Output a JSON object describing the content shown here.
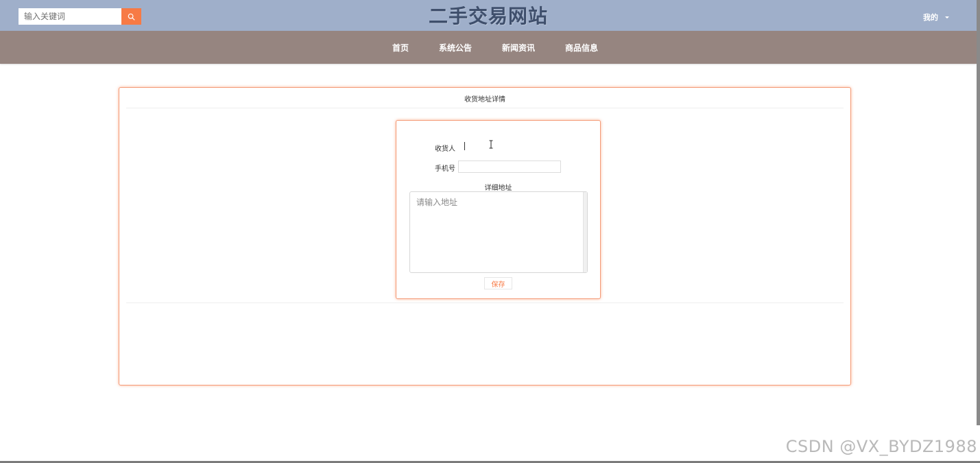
{
  "header": {
    "search": {
      "placeholder": "输入关键词",
      "value": ""
    },
    "site_title": "二手交易网站",
    "user_menu_label": "我的"
  },
  "nav": {
    "items": [
      {
        "label": "首页"
      },
      {
        "label": "系统公告"
      },
      {
        "label": "新闻资讯"
      },
      {
        "label": "商品信息"
      }
    ]
  },
  "main": {
    "card_title": "收货地址详情",
    "form": {
      "receiver_label": "收货人",
      "phone_label": "手机号",
      "phone_value": "",
      "address_label": "详细地址",
      "address_placeholder": "请输入地址",
      "save_label": "保存"
    }
  },
  "watermark": "CSDN @VX_BYDZ1988",
  "colors": {
    "header_bg": "#9fafca",
    "nav_bg": "#968580",
    "accent": "#f77a45",
    "card_border": "#f49a76"
  },
  "icons": {
    "search_button": "search-icon",
    "user_menu_caret": "caret-down-icon",
    "text_cursor": "ibeam-cursor-icon"
  }
}
